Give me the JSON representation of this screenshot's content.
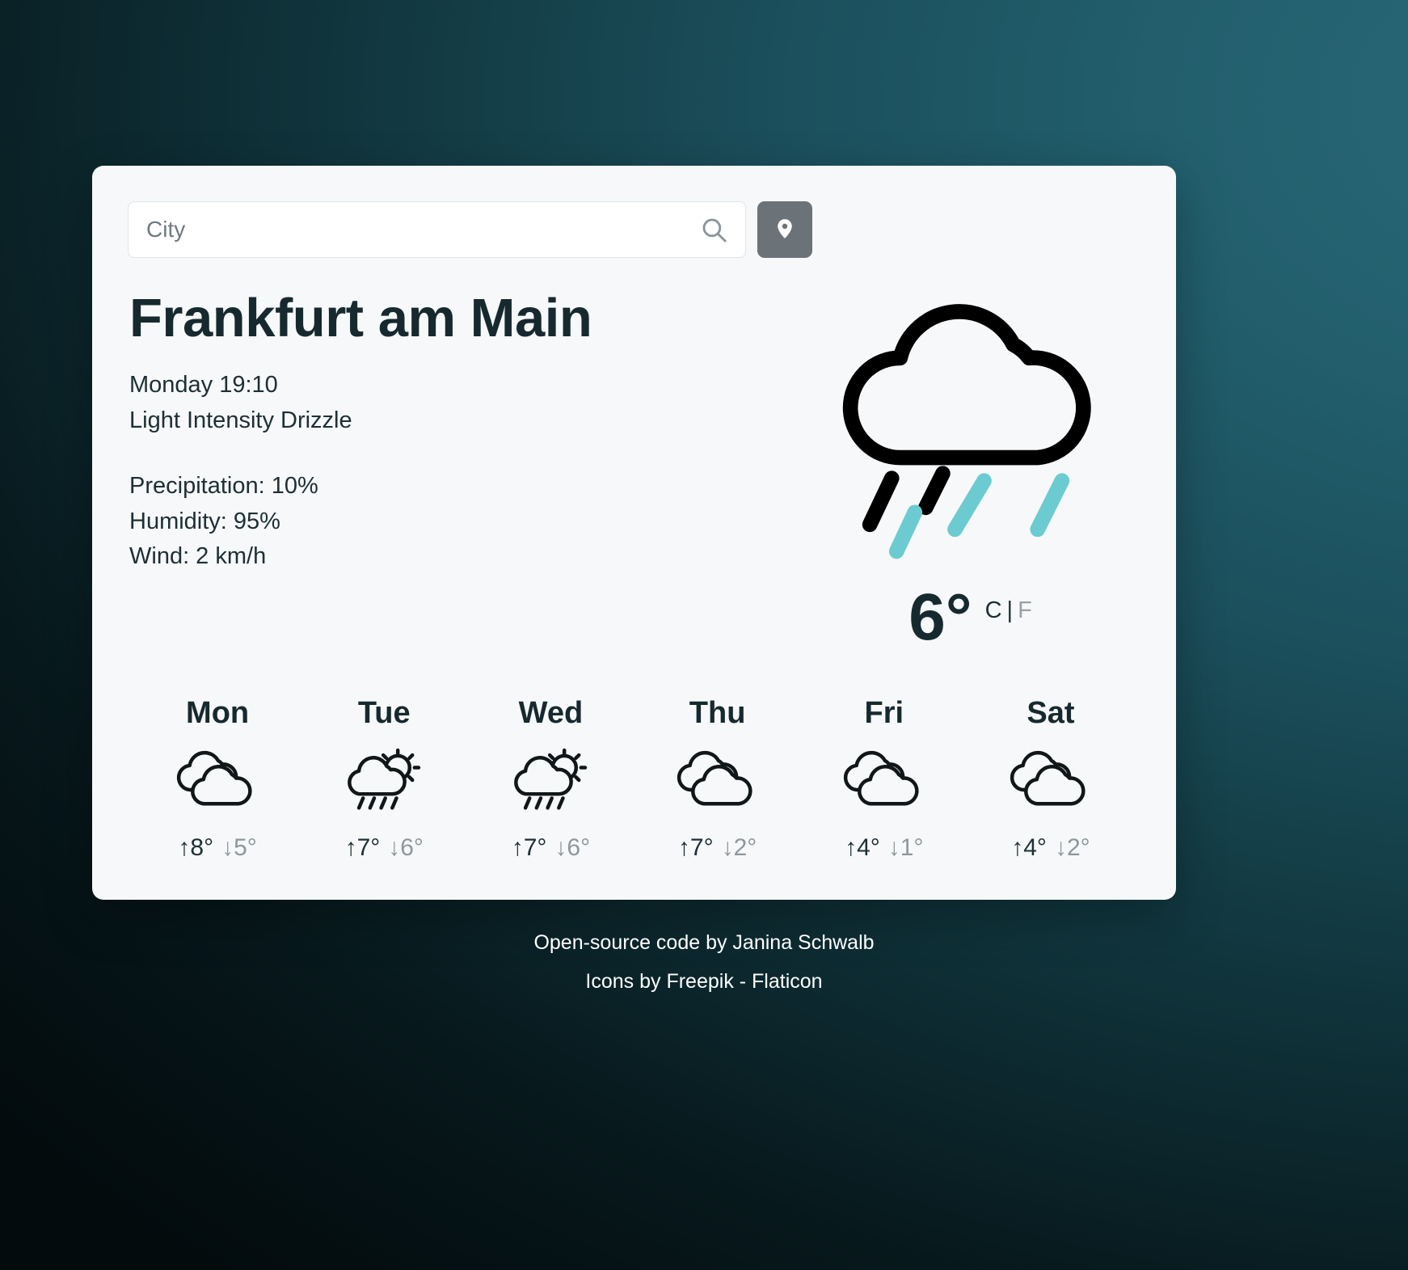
{
  "search": {
    "placeholder": "City",
    "value": "",
    "icon": "search-icon",
    "location_button_icon": "map-pin-icon"
  },
  "current": {
    "city": "Frankfurt am Main",
    "datetime": "Monday 19:10",
    "description": "Light Intensity Drizzle",
    "precipitation": "Precipitation: 10%",
    "humidity": "Humidity: 95%",
    "wind": "Wind: 2 km/h",
    "temperature": "6°",
    "unit_celsius": "C",
    "unit_separator": "|",
    "unit_fahrenheit": "F",
    "icon": "cloud-with-rain-icon"
  },
  "forecast": [
    {
      "day": "Mon",
      "icon": "cloudy-icon",
      "max": "↑8°",
      "min": "↓5°"
    },
    {
      "day": "Tue",
      "icon": "sun-cloud-rain-icon",
      "max": "↑7°",
      "min": "↓6°"
    },
    {
      "day": "Wed",
      "icon": "sun-cloud-rain-icon",
      "max": "↑7°",
      "min": "↓6°"
    },
    {
      "day": "Thu",
      "icon": "cloudy-icon",
      "max": "↑7°",
      "min": "↓2°"
    },
    {
      "day": "Fri",
      "icon": "cloudy-icon",
      "max": "↑4°",
      "min": "↓1°"
    },
    {
      "day": "Sat",
      "icon": "cloudy-icon",
      "max": "↑4°",
      "min": "↓2°"
    }
  ],
  "footer": {
    "line1": "Open-source code by Janina Schwalb",
    "line2": "Icons by Freepik - Flaticon"
  },
  "colors": {
    "card_background": "#f7f8f9",
    "text_dark": "#16292e",
    "text_muted": "#8e979b",
    "rain_accent": "#6ccbd1",
    "location_button": "#6b7278",
    "background_teal": "#255d6b",
    "background_dark": "#050f11"
  }
}
